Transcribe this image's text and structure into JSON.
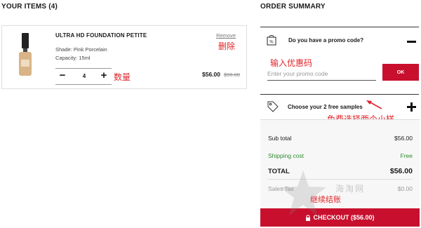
{
  "cart": {
    "title": "YOUR ITEMS (4)",
    "item": {
      "name": "ULTRA HD FOUNDATION PETITE",
      "shade": "Shade: Pink Porcelain",
      "capacity": "Capacity: 15ml",
      "remove_label": "Remove",
      "quantity": "4",
      "price": "$56.00",
      "original_price": "$96.00",
      "image_icon": "foundation-bottle-icon"
    }
  },
  "summary": {
    "title": "ORDER SUMMARY",
    "promo": {
      "title": "Do you have a promo code?",
      "placeholder": "Enter your promo code",
      "button_label": "OK",
      "icon": "percent-tag-icon"
    },
    "samples": {
      "title": "Choose your 2 free samples",
      "icon": "tag-icon"
    },
    "rows": {
      "subtotal_label": "Sub total",
      "subtotal_value": "$56.00",
      "shipping_label": "Shipping cost",
      "shipping_value": "Free",
      "total_label": "TOTAL",
      "total_value": "$56.00",
      "tax_label": "Sales Tax",
      "tax_value": "$0.00"
    },
    "checkout_label": "CHECKOUT ($56.00)"
  },
  "annotations": {
    "remove": "删除",
    "quantity": "数量",
    "promo": "输入优惠码",
    "samples": "免费选择两个小样",
    "checkout": "继续结账"
  },
  "watermark": {
    "text": "海淘网"
  },
  "colors": {
    "accent_red": "#c8102e",
    "annotation_red": "#e1252b",
    "free_green": "#2e8b2e"
  }
}
